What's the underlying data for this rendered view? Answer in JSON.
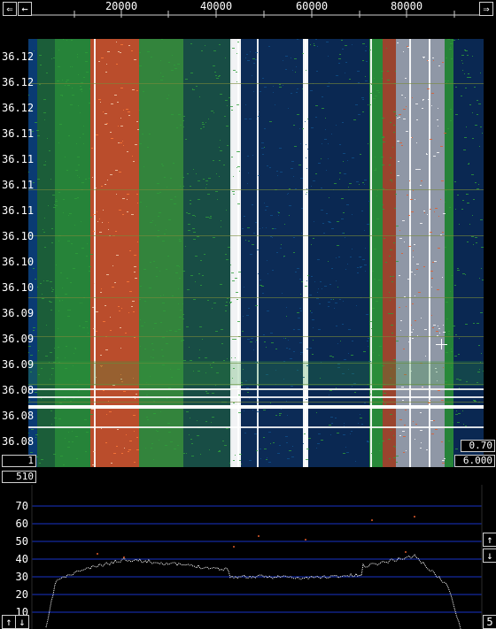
{
  "freq_axis": {
    "ticks": [
      "20000",
      "40000",
      "60000",
      "80000"
    ],
    "left_arrow": "⇐",
    "right_arrow": "⇒"
  },
  "waterfall": {
    "time_labels": [
      "36.12",
      "36.12",
      "36.12",
      "36.11",
      "36.11",
      "36.11",
      "36.11",
      "36.10",
      "36.10",
      "36.10",
      "36.09",
      "36.09",
      "36.09",
      "36.08",
      "36.08",
      "36.08"
    ],
    "bottom_left_value": "1",
    "right_top_value": "0.70",
    "right_bottom_value": "6.000",
    "under_left_value": "510"
  },
  "spectrum": {
    "db_labels": [
      "70",
      "60",
      "50",
      "40",
      "30",
      "20",
      "10"
    ],
    "right_scale_value": "5",
    "up_arrow": "↑",
    "down_arrow": "↓"
  },
  "colors": {
    "background": "#000000",
    "deep_blue": "#071a3a",
    "green": "#2e9d3a",
    "orange": "#e25b2a",
    "white": "#ffffff",
    "grid_blue": "#1834c8"
  }
}
